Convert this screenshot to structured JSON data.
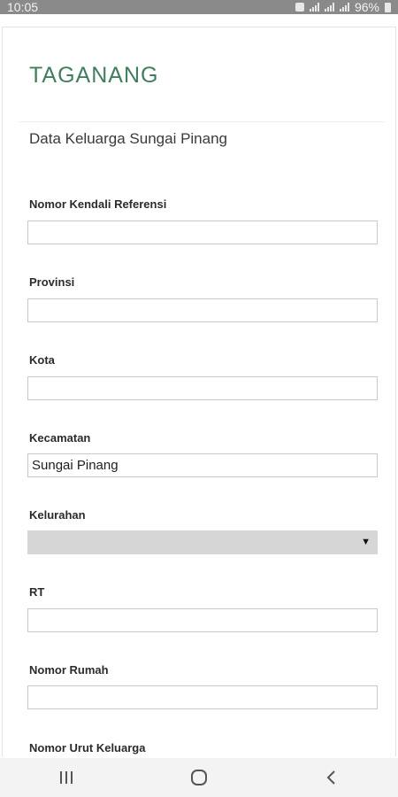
{
  "status_bar": {
    "time": "10:05",
    "battery_text": "96%",
    "icons": [
      "notification-icon",
      "signal-icon",
      "wifi-icon",
      "signal-icon",
      "battery-icon"
    ]
  },
  "app": {
    "title": "TAGANANG",
    "subtitle": "Data Keluarga Sungai Pinang"
  },
  "form": {
    "fields": [
      {
        "label": "Nomor Kendali Referensi",
        "value": ""
      },
      {
        "label": "Provinsi",
        "value": ""
      },
      {
        "label": "Kota",
        "value": ""
      },
      {
        "label": "Kecamatan",
        "value": "Sungai Pinang"
      },
      {
        "label": "Kelurahan",
        "value": "",
        "type": "select"
      },
      {
        "label": "RT",
        "value": ""
      },
      {
        "label": "Nomor Rumah",
        "value": ""
      },
      {
        "label": "Nomor Urut Keluarga",
        "value": ""
      }
    ]
  },
  "nav_bar": {
    "icons": [
      "recent-apps-icon",
      "home-icon",
      "back-icon"
    ]
  },
  "colors": {
    "title": "#3f7f5d",
    "status_bar": "#8a8a8a",
    "select_bg": "#d6d6d6"
  }
}
